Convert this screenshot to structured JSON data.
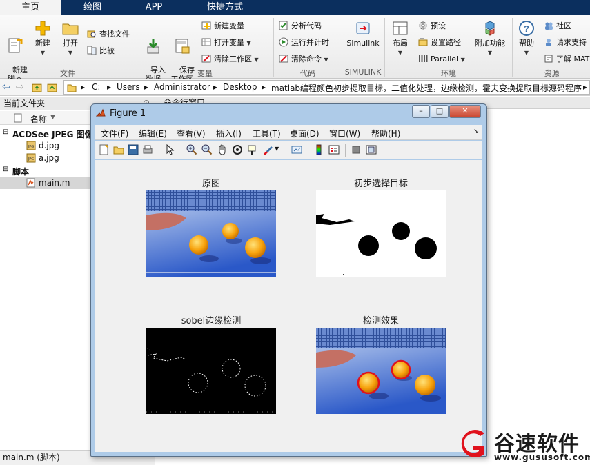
{
  "tabs": [
    "主页",
    "绘图",
    "APP",
    "快捷方式"
  ],
  "ribbon": {
    "file": {
      "new_script": "新建\n脚本",
      "new": "新建",
      "open": "打开",
      "find_files": "查找文件",
      "compare": "比较",
      "group": "文件"
    },
    "variable": {
      "import": "导入\n数据",
      "save_ws": "保存\n工作区",
      "new_var": "新建变量",
      "open_var": "打开变量",
      "clear_ws": "清除工作区",
      "group": "变量"
    },
    "code": {
      "analyze": "分析代码",
      "run_time": "运行并计时",
      "clear_cmd": "清除命令",
      "group": "代码"
    },
    "simulink": {
      "label": "Simulink",
      "group": "SIMULINK"
    },
    "env": {
      "layout": "布局",
      "prefs": "预设",
      "set_path": "设置路径",
      "parallel": "Parallel",
      "addons": "附加功能",
      "group": "环境"
    },
    "resources": {
      "help": "帮助",
      "community": "社区",
      "support": "请求支持",
      "learn": "了解 MAT",
      "group": "资源"
    }
  },
  "address": {
    "parts": [
      "C:",
      "Users",
      "Administrator",
      "Desktop",
      "matlab编程颜色初步提取目标，二值化处理，边缘检测，霍夫变换提取目标源码程序"
    ]
  },
  "left_panel": {
    "title": "当前文件夹",
    "col_name": "名称",
    "group1": "ACDSee JPEG 图像",
    "files1": [
      "d.jpg",
      "a.jpg"
    ],
    "group2": "脚本",
    "files2": [
      "main.m"
    ],
    "status": "main.m  (脚本)"
  },
  "command_window": {
    "title": "命令行窗口"
  },
  "figure": {
    "title": "Figure 1",
    "menu": [
      "文件(F)",
      "编辑(E)",
      "查看(V)",
      "插入(I)",
      "工具(T)",
      "桌面(D)",
      "窗口(W)",
      "帮助(H)"
    ],
    "plots": [
      {
        "title": "原图"
      },
      {
        "title": "初步选择目标"
      },
      {
        "title": "sobel边缘检测"
      },
      {
        "title": "检测效果"
      }
    ]
  },
  "watermark": {
    "name": "谷速软件",
    "url": "www.gususoft.com"
  },
  "colors": {
    "tab_bar": "#0b2f5e",
    "figure_frame": "#aecbe8",
    "ball_orange": "#f7a20c",
    "detect_red": "#e0121c"
  }
}
